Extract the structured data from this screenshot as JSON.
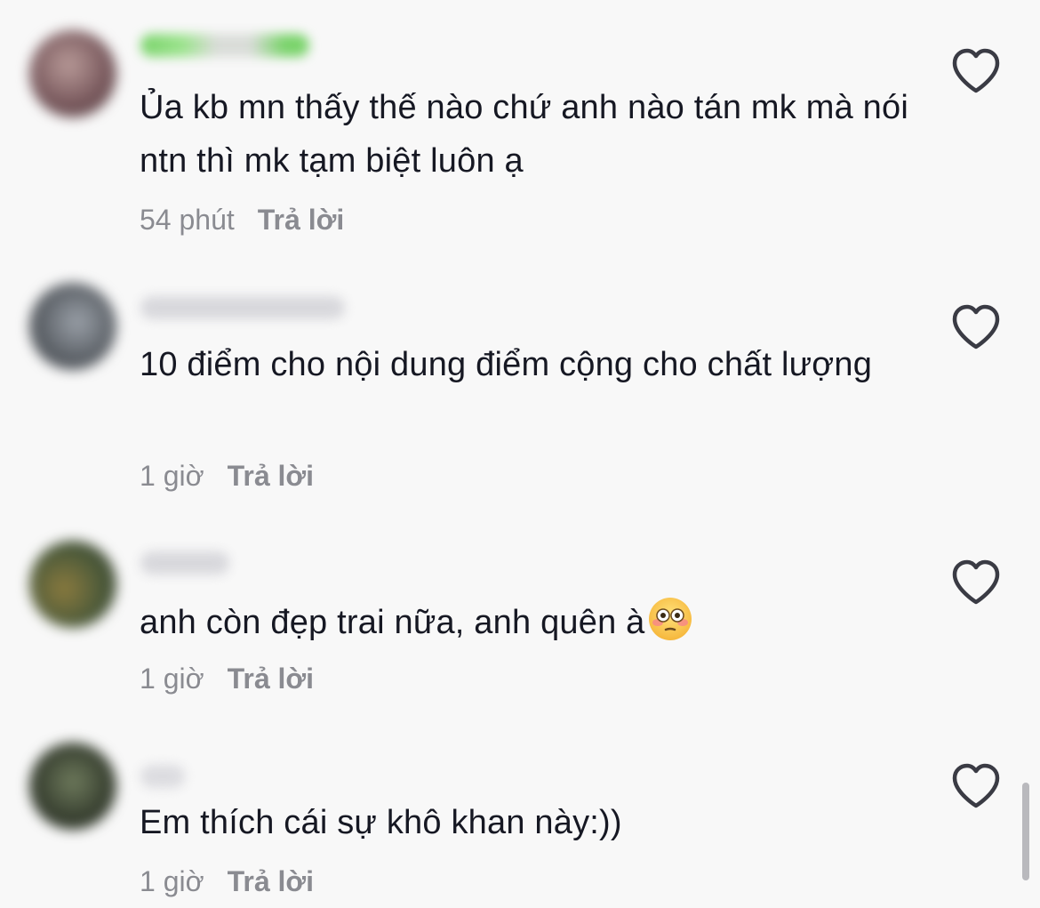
{
  "comments": [
    {
      "text": "Ủa kb mn thấy thế nào chứ anh nào tán mk mà nói ntn thì mk tạm biệt luôn ạ",
      "time": "54 phút",
      "reply": "Trả lời",
      "avatar_color": "#7a5a5e",
      "username_color": "#7ad36b"
    },
    {
      "text": "10 điểm cho nội dung điểm cộng cho chất lượng",
      "time": "1 giờ",
      "reply": "Trả lời",
      "avatar_color": "#5d6268",
      "username_color": "#d4d4d8"
    },
    {
      "text": "anh còn đẹp trai nữa, anh quên à",
      "emoji": "flushed-face",
      "time": "1 giờ",
      "reply": "Trả lời",
      "avatar_color": "#4c5a3a",
      "username_color": "#d4d4d8"
    },
    {
      "text": "Em thích cái sự khô khan này:))",
      "time": "1 giờ",
      "reply": "Trả lời",
      "avatar_color": "#3a4232",
      "username_color": "#dcdce0"
    }
  ],
  "icons": {
    "like": "heart-outline-icon"
  },
  "colors": {
    "background": "#f8f8f8",
    "text": "#161823",
    "meta": "#8a8b91"
  }
}
